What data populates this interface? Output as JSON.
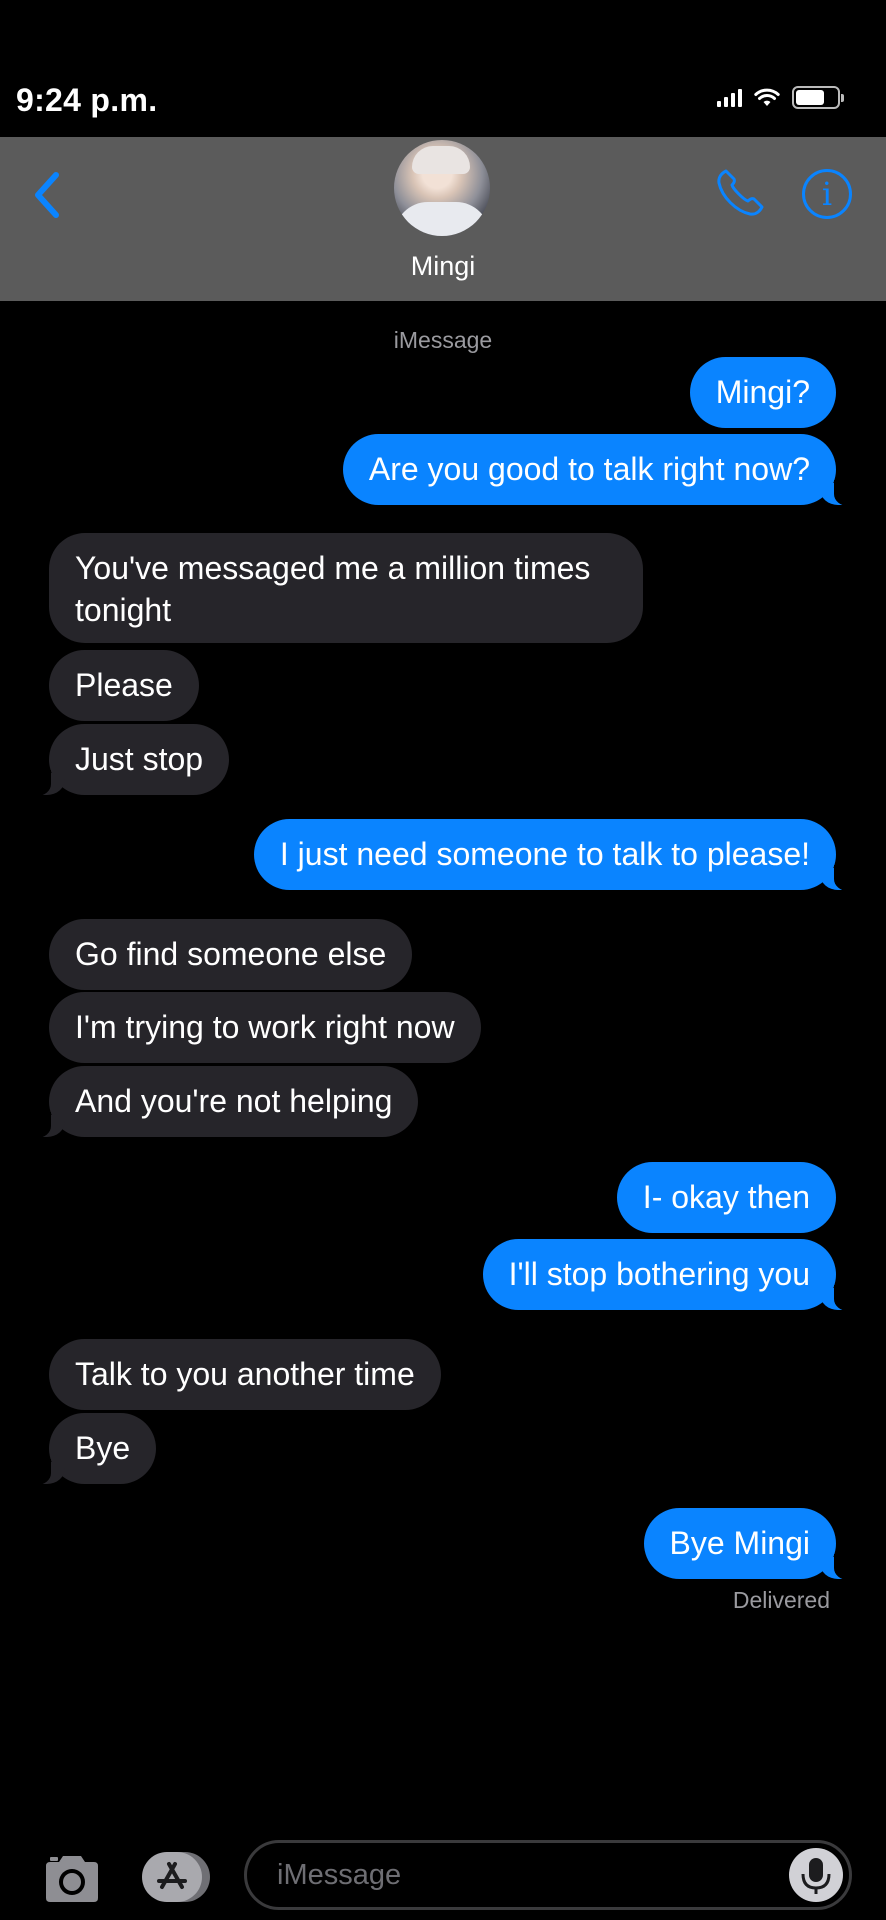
{
  "status_bar": {
    "time": "9:24 p.m."
  },
  "header": {
    "contact_name": "Mingi",
    "service_label": "iMessage"
  },
  "messages": [
    {
      "side": "sent",
      "text": "Mingi?"
    },
    {
      "side": "sent",
      "text": "Are you good to talk right now?"
    },
    {
      "side": "received",
      "text": "You've messaged me a million times tonight"
    },
    {
      "side": "received",
      "text": "Please"
    },
    {
      "side": "received",
      "text": "Just stop"
    },
    {
      "side": "sent",
      "text": "I just need someone to talk to please!"
    },
    {
      "side": "received",
      "text": "Go find someone else"
    },
    {
      "side": "received",
      "text": "I'm trying to work right now"
    },
    {
      "side": "received",
      "text": "And you're not helping"
    },
    {
      "side": "sent",
      "text": "I- okay then"
    },
    {
      "side": "sent",
      "text": "I'll stop bothering you"
    },
    {
      "side": "received",
      "text": "Talk to you another time"
    },
    {
      "side": "received",
      "text": "Bye"
    },
    {
      "side": "sent",
      "text": "Bye Mingi"
    }
  ],
  "delivery_status": "Delivered",
  "input": {
    "placeholder": "iMessage"
  },
  "colors": {
    "sent_bubble": "#0a84ff",
    "received_bubble": "#26252a",
    "header_bg": "#5b5b5b",
    "accent": "#0a84ff"
  },
  "icons": [
    "chevron-left-icon",
    "phone-icon",
    "info-icon",
    "camera-icon",
    "app-store-icon",
    "microphone-icon",
    "signal-icon",
    "wifi-icon",
    "battery-icon"
  ]
}
